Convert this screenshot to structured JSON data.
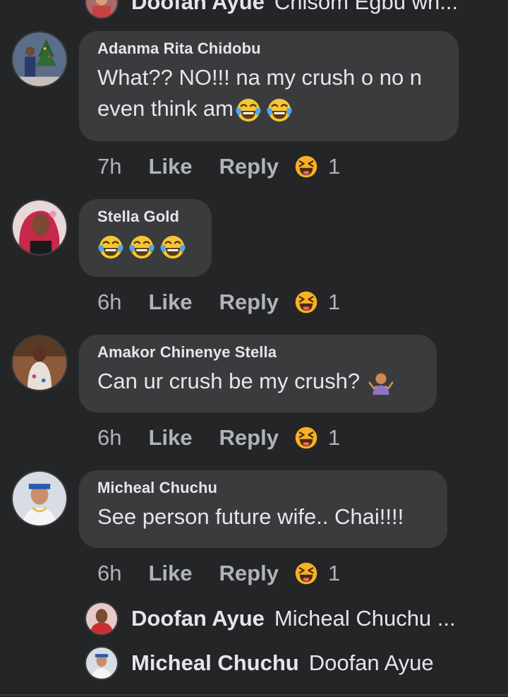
{
  "top_reply": {
    "name": "Doofan Ayue",
    "text": "Chisom Egbu wh..."
  },
  "comments": [
    {
      "author": "Adanma Rita Chidobu",
      "line1": "What?? NO!!! na my crush o no n",
      "line2": "even think am",
      "time": "7h",
      "like": "Like",
      "reply": "Reply",
      "count": "1",
      "emoji": [
        "face-with-tears-of-joy",
        "face-with-tears-of-joy"
      ]
    },
    {
      "author": "Stella Gold",
      "line1": "",
      "time": "6h",
      "like": "Like",
      "reply": "Reply",
      "count": "1",
      "emoji": [
        "face-with-tears-of-joy",
        "face-with-tears-of-joy",
        "face-with-tears-of-joy"
      ]
    },
    {
      "author": "Amakor Chinenye Stella",
      "line1": "Can ur crush be my crush?",
      "time": "6h",
      "like": "Like",
      "reply": "Reply",
      "count": "1",
      "emoji": [
        "person-shrugging"
      ]
    },
    {
      "author": "Micheal Chuchu",
      "line1": "See person future wife.. Chai!!!!",
      "time": "6h",
      "like": "Like",
      "reply": "Reply",
      "count": "1",
      "emoji": []
    }
  ],
  "replies": [
    {
      "name": "Doofan Ayue",
      "text": "Micheal Chuchu ..."
    },
    {
      "name": "Micheal Chuchu",
      "text": "Doofan Ayue"
    }
  ],
  "colors": {
    "background": "#242526",
    "bubble": "#3a3b3c",
    "text": "#e4e6eb",
    "meta": "#b0b3b8",
    "haha": "#f7b125"
  }
}
